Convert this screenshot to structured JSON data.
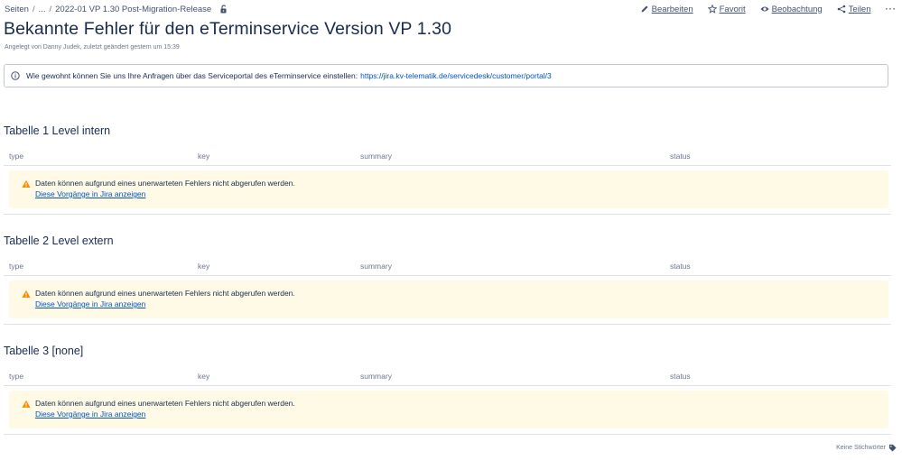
{
  "breadcrumb": {
    "items": [
      "Seiten",
      "...",
      "2022-01 VP 1.30 Post-Migration-Release"
    ],
    "separator": "/"
  },
  "actions": {
    "edit": {
      "label": "Bearbeiten",
      "icon": "pencil-icon"
    },
    "favorite": {
      "label": "Favorit",
      "icon": "star-icon"
    },
    "watch": {
      "label": "Beobachtung",
      "icon": "eye-icon"
    },
    "share": {
      "label": "Teilen",
      "icon": "share-icon"
    },
    "more": "···"
  },
  "page": {
    "title": "Bekannte Fehler für den eTerminservice Version VP 1.30",
    "byline": "Angelegt von Danny Judek, zuletzt geändert gestern um 15:39"
  },
  "info": {
    "text": "Wie gewohnt können Sie uns Ihre Anfragen über das Serviceportal des eTerminservice einstellen:",
    "link": "https://jira.kv-telematik.de/servicedesk/customer/portal/3"
  },
  "columns": [
    "type",
    "key",
    "summary",
    "status"
  ],
  "sections": [
    {
      "title": "Tabelle 1 Level intern",
      "message": "Daten können aufgrund eines unerwarteten Fehlers nicht abgerufen werden.",
      "link": "Diese Vorgänge in Jira anzeigen"
    },
    {
      "title": "Tabelle 2 Level extern",
      "message": "Daten können aufgrund eines unerwarteten Fehlers nicht abgerufen werden.",
      "link": "Diese Vorgänge in Jira anzeigen"
    },
    {
      "title": "Tabelle 3 [none]",
      "message": "Daten können aufgrund eines unerwarteten Fehlers nicht abgerufen werden.",
      "link": "Diese Vorgänge in Jira anzeigen"
    }
  ],
  "footer": {
    "labels": "Keine Stichwörter"
  },
  "colors": {
    "link": "#0052cc",
    "text": "#172b4d",
    "warning_bg": "#fffae6",
    "warning_icon": "#ff8b00"
  }
}
